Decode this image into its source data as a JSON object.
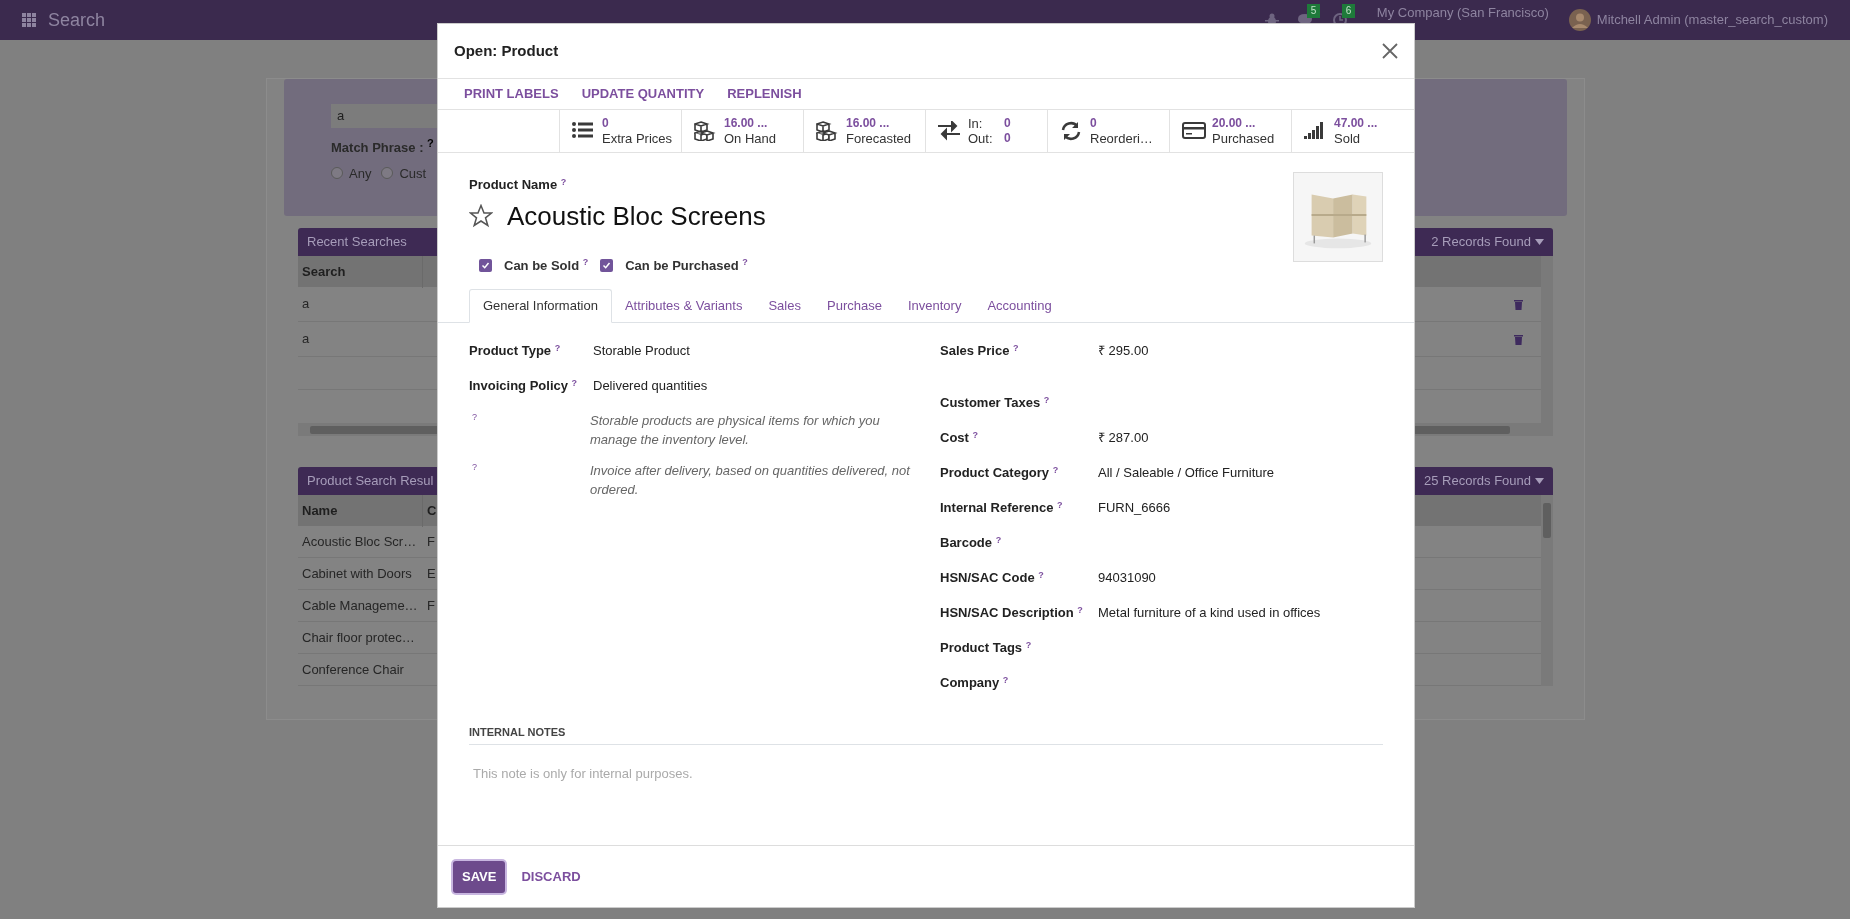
{
  "navbar": {
    "app_title": "Search",
    "messages_count": "5",
    "activities_count": "6",
    "company": "My Company (San Francisco)",
    "user": "Mitchell Admin (master_search_custom)"
  },
  "search_panel": {
    "query": "a",
    "match_phrase_label": "Match Phrase : $^{?}$",
    "options": [
      {
        "label": "Any",
        "selected": false
      },
      {
        "label": "Cust",
        "selected": false
      }
    ]
  },
  "recent_searches": {
    "title": "Recent Searches",
    "records_found": "2 Records Found",
    "columns": [
      "Search"
    ],
    "rows": [
      "a",
      "a"
    ]
  },
  "product_results": {
    "title": "Product Search Resul",
    "records_found": "25 Records Found",
    "columns": [
      "Name",
      "C"
    ],
    "rows": [
      [
        "Acoustic Bloc Scr…",
        "F"
      ],
      [
        "Cabinet with Doors",
        "E"
      ],
      [
        "Cable Manageme…",
        "F"
      ],
      [
        "Chair floor protec…",
        ""
      ],
      [
        "Conference Chair",
        ""
      ]
    ]
  },
  "dialog": {
    "title": "Open: Product",
    "actions": [
      "PRINT LABELS",
      "UPDATE QUANTITY",
      "REPLENISH"
    ],
    "stat_buttons": [
      {
        "kind": "value",
        "value": "0",
        "label": "Extra Prices"
      },
      {
        "kind": "value",
        "value": "16.00 ...",
        "label": "On Hand"
      },
      {
        "kind": "value",
        "value": "16.00 ...",
        "label": "Forecasted"
      },
      {
        "kind": "in_out",
        "in_label": "In:",
        "in_value": "0",
        "out_label": "Out:",
        "out_value": "0"
      },
      {
        "kind": "value",
        "value": "0",
        "label": "Reorderi…"
      },
      {
        "kind": "value",
        "value": "20.00 ...",
        "label": "Purchased"
      },
      {
        "kind": "value",
        "value": "47.00 ...",
        "label": "Sold"
      }
    ],
    "product_name_label": "Product Name $^{?}$",
    "favorite": false,
    "product_name": "Acoustic Bloc Screens",
    "options": [
      {
        "label": "Can be Sold $^{?}$",
        "checked": true
      },
      {
        "label": "Can be Purchased $^{?}$",
        "checked": true
      }
    ],
    "tabs": [
      {
        "label": "General Information",
        "selected": true
      },
      {
        "label": "Attributes & Variants",
        "selected": false
      },
      {
        "label": "Sales",
        "selected": false
      },
      {
        "label": "Purchase",
        "selected": false
      },
      {
        "label": "Inventory",
        "selected": false
      },
      {
        "label": "Accounting",
        "selected": false
      }
    ],
    "left_fields": [
      {
        "label": "Product Type $^{?}$",
        "value": "Storable Product"
      },
      {
        "label": "Invoicing Policy $^{?}$",
        "value": "Delivered quantities"
      }
    ],
    "help_notes": [
      {
        "mark": "?",
        "text": "Storable products are physical items for which you manage the inventory level."
      },
      {
        "mark": "?",
        "text": "Invoice after delivery, based on quantities delivered, not ordered."
      }
    ],
    "right_fields": [
      {
        "label": "Sales Price $^{?}$",
        "value": "₹ 295.00"
      },
      {
        "label": "Customer Taxes $^{?}$"
      },
      {
        "label": "Cost $^{?}$",
        "value": "₹ 287.00"
      },
      {
        "label": "Product Category $^{?}$",
        "value": "All / Saleable / Office Furniture"
      },
      {
        "label": "Internal Reference $^{?}$",
        "value": "FURN_6666"
      },
      {
        "label": "Barcode $^{?}$"
      },
      {
        "label": "HSN/SAC Code $^{?}$",
        "value": "94031090"
      },
      {
        "label": "HSN/SAC Description $^{?}$",
        "value": "Metal furniture of a kind used in offices"
      },
      {
        "label": "Product Tags $^{?}$"
      },
      {
        "label": "Company $^{?}$"
      }
    ],
    "notes_heading": "INTERNAL NOTES",
    "notes_placeholder": "This note is only for internal purposes.",
    "footer_buttons": [
      {
        "kind": "primary",
        "label": "SAVE"
      },
      {
        "kind": "link",
        "label": "DISCARD"
      }
    ]
  }
}
